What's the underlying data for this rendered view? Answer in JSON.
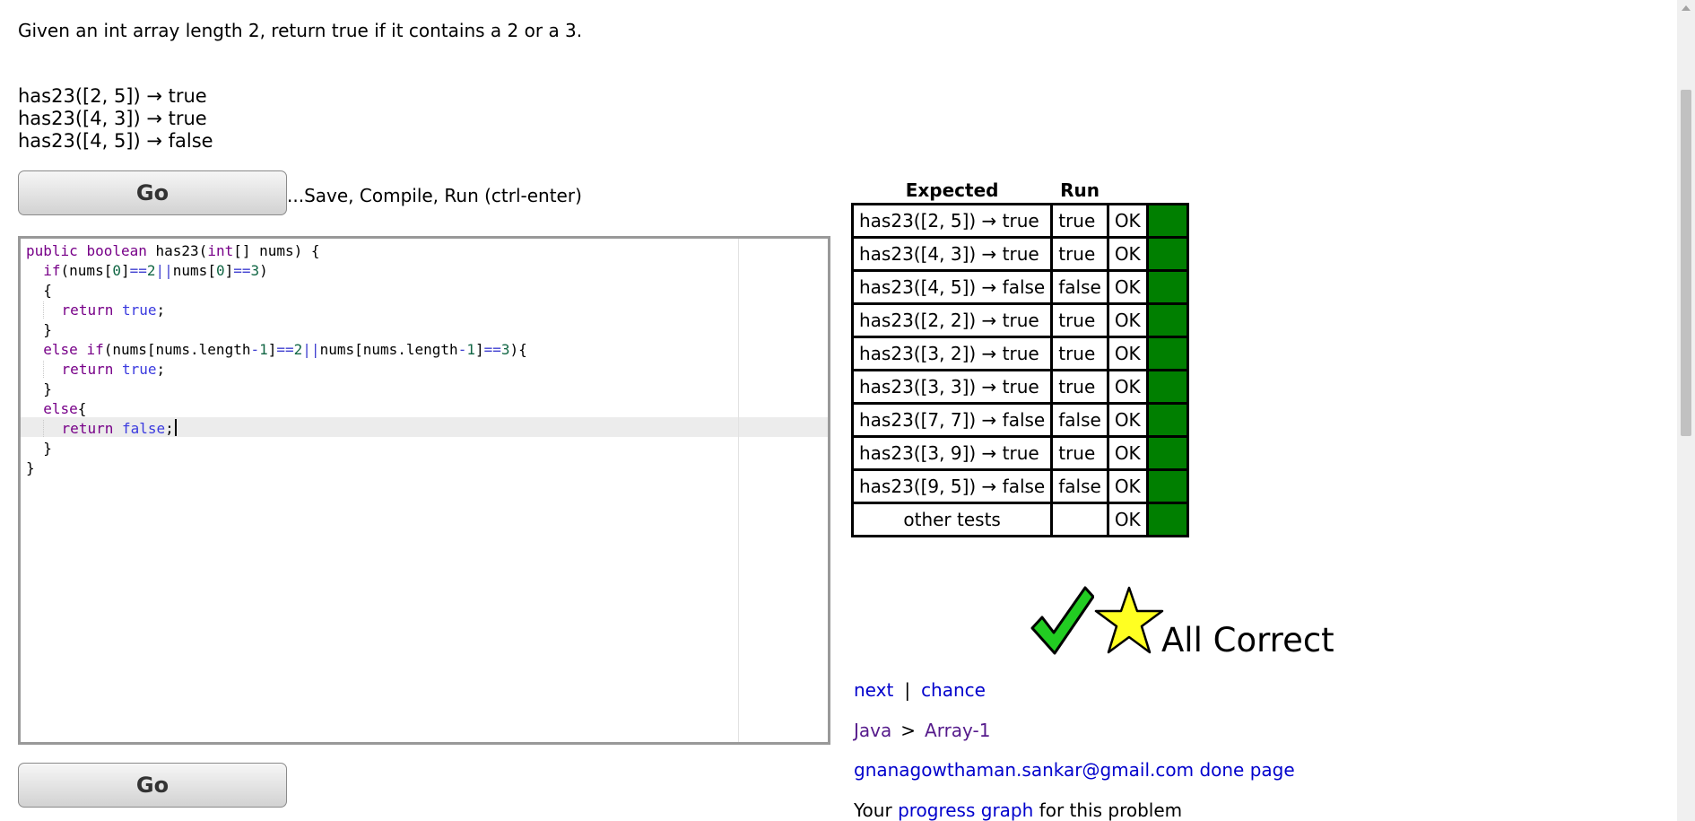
{
  "problem": {
    "description": "Given an int array length 2, return true if it contains a 2 or a 3.",
    "examples": [
      "has23([2, 5]) → true",
      "has23([4, 3]) → true",
      "has23([4, 5]) → false"
    ]
  },
  "toolbar": {
    "go_label": "Go",
    "go_hint": "...Save, Compile, Run (ctrl-enter)"
  },
  "editor": {
    "code": "public boolean has23(int[] nums) {\n  if(nums[0]==2||nums[0]==3)\n  {\n    return true;\n  }\n  else if(nums[nums.length-1]==2||nums[nums.length-1]==3){\n    return true;\n  }\n  else{\n    return false;\n  }\n}"
  },
  "results": {
    "headers": {
      "expected": "Expected",
      "run": "Run"
    },
    "rows": [
      {
        "expected": "has23([2, 5]) → true",
        "run": "true",
        "status": "OK"
      },
      {
        "expected": "has23([4, 3]) → true",
        "run": "true",
        "status": "OK"
      },
      {
        "expected": "has23([4, 5]) → false",
        "run": "false",
        "status": "OK"
      },
      {
        "expected": "has23([2, 2]) → true",
        "run": "true",
        "status": "OK"
      },
      {
        "expected": "has23([3, 2]) → true",
        "run": "true",
        "status": "OK"
      },
      {
        "expected": "has23([3, 3]) → true",
        "run": "true",
        "status": "OK"
      },
      {
        "expected": "has23([7, 7]) → false",
        "run": "false",
        "status": "OK"
      },
      {
        "expected": "has23([3, 9]) → true",
        "run": "true",
        "status": "OK"
      },
      {
        "expected": "has23([9, 5]) → false",
        "run": "false",
        "status": "OK"
      },
      {
        "expected": "other tests",
        "run": "",
        "status": "OK"
      }
    ],
    "pass_color": "#007f00"
  },
  "verdict": {
    "text": "All Correct",
    "icons": [
      "checkmark-icon",
      "star-icon"
    ]
  },
  "nav": {
    "next": "next",
    "separator": "|",
    "chance": "chance"
  },
  "breadcrumb": {
    "language": "Java",
    "separator": ">",
    "section": "Array-1"
  },
  "user": {
    "email": "gnanagowthaman.sankar@gmail.com",
    "done_page": "done page"
  },
  "progress": {
    "prefix": "Your",
    "link": "progress graph",
    "suffix": "for this problem"
  }
}
